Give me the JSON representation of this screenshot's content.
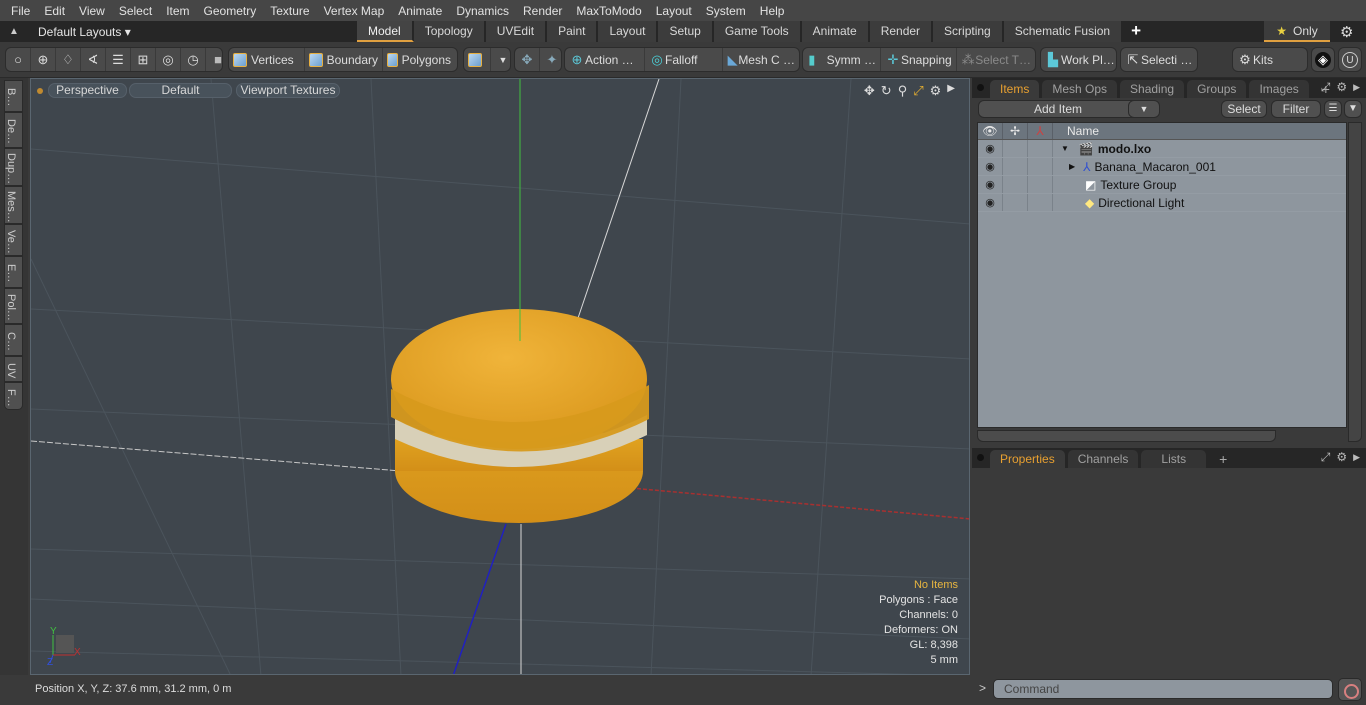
{
  "menu": [
    "File",
    "Edit",
    "View",
    "Select",
    "Item",
    "Geometry",
    "Texture",
    "Vertex Map",
    "Animate",
    "Dynamics",
    "Render",
    "MaxToModo",
    "Layout",
    "System",
    "Help"
  ],
  "layoutbar": {
    "layouts_label": "Default Layouts ▾",
    "tabs": [
      "Model",
      "Topology",
      "UVEdit",
      "Paint",
      "Layout",
      "Setup",
      "Game Tools",
      "Animate",
      "Render",
      "Scripting",
      "Schematic Fusion"
    ],
    "active_tab": "Model",
    "only_label": "Only"
  },
  "toolbar": {
    "vertices": "Vertices",
    "boundary": "Boundary",
    "polygons": "Polygons",
    "action": "Action …",
    "falloff": "Falloff",
    "mesh_c": "Mesh C …",
    "symm": "Symm …",
    "snapping": "Snapping",
    "select_t": "Select T…",
    "work_pl": "Work Pl…",
    "selecti": "Selecti …",
    "kits": "Kits"
  },
  "left_tabs": [
    "B…",
    "De…",
    "Dup…",
    "Mes…",
    "Ve…",
    "E…",
    "Pol…",
    "C…",
    "UV",
    "F…"
  ],
  "viewport": {
    "view_mode": "Perspective",
    "shading": "Default",
    "textures": "Viewport Textures",
    "info": {
      "selection": "No Items",
      "polygons": "Polygons : Face",
      "channels": "Channels: 0",
      "deformers": "Deformers: ON",
      "gl": "GL: 8,398",
      "scale": "5 mm"
    },
    "axis_labels": {
      "x": "X",
      "y": "Y",
      "z": "Z"
    }
  },
  "status": {
    "position": "Position X, Y, Z:   37.6 mm, 31.2 mm, 0 m"
  },
  "items_panel": {
    "tabs": [
      "Items",
      "Mesh Ops",
      "Shading",
      "Groups",
      "Images"
    ],
    "active_tab": "Items",
    "add_item": "Add Item",
    "select": "Select",
    "filter": "Filter",
    "column_name": "Name",
    "rows": [
      {
        "name": "modo.lxo",
        "bold": true
      },
      {
        "name": "Banana_Macaron_001"
      },
      {
        "name": "Texture Group"
      },
      {
        "name": "Directional Light"
      }
    ]
  },
  "properties_panel": {
    "tabs": [
      "Properties",
      "Channels",
      "Lists"
    ],
    "active_tab": "Properties"
  },
  "command": {
    "placeholder": "Command",
    "prompt": ">"
  }
}
